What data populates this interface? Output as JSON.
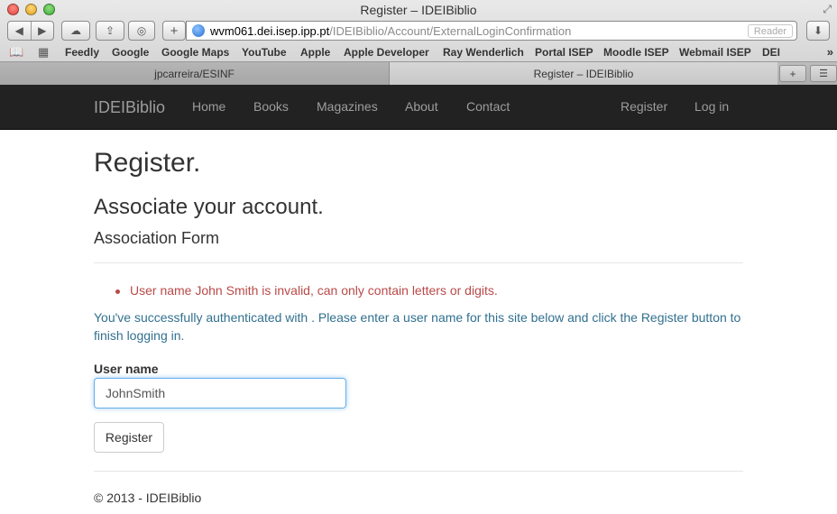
{
  "window": {
    "title": "Register – IDEIBiblio"
  },
  "toolbar": {
    "back_icon": "back-arrow-icon",
    "forward_icon": "forward-arrow-icon",
    "url_host": "wvm061.dei.isep.ipp.pt",
    "url_path": "/IDEIBiblio/Account/ExternalLoginConfirmation",
    "reader_label": "Reader"
  },
  "bookmarks": {
    "items": [
      "Feedly",
      "Google",
      "Google Maps",
      "YouTube",
      "Apple",
      "Apple Developer",
      "Ray Wenderlich",
      "Portal ISEP",
      "Moodle ISEP",
      "Webmail ISEP",
      "DEI"
    ],
    "more": "»"
  },
  "tabs": [
    {
      "label": "jpcarreira/ESINF"
    },
    {
      "label": "Register – IDEIBiblio"
    }
  ],
  "nav": {
    "brand": "IDEIBiblio",
    "links": [
      "Home",
      "Books",
      "Magazines",
      "About",
      "Contact"
    ],
    "right": [
      "Register",
      "Log in"
    ]
  },
  "main": {
    "title": "Register.",
    "subtitle": "Associate your account.",
    "form_title": "Association Form",
    "error": "User name John Smith is invalid, can only contain letters or digits.",
    "info": "You've successfully authenticated with . Please enter a user name for this site below and click the Register button to finish logging in.",
    "username_label": "User name",
    "username_value": "JohnSmith",
    "register_button": "Register"
  },
  "footer": {
    "text": "© 2013 - IDEIBiblio"
  },
  "colors": {
    "navbar": "#222222",
    "error": "#b94a48",
    "info": "#31708f",
    "input_focus": "#66afe9"
  }
}
